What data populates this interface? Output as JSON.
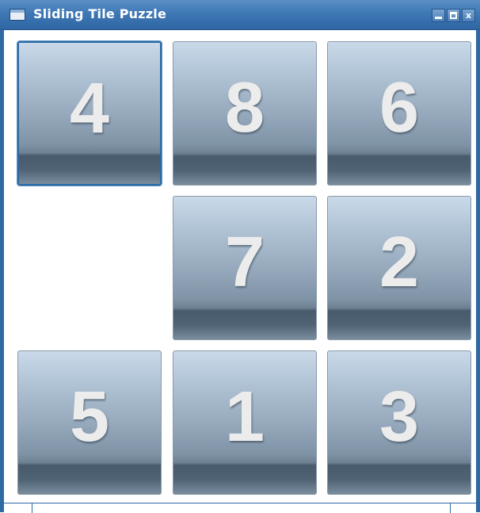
{
  "window": {
    "title": "Sliding Tile Puzzle",
    "buttons": {
      "close_label": "x"
    }
  },
  "colors": {
    "titlebar": "#3e78b5",
    "tile_top": "#c9d9e9",
    "tile_bottom": "#485b6c",
    "tile_text": "#ececec",
    "focus_border": "#2d6aa3"
  },
  "board": {
    "rows": [
      [
        "4",
        "8",
        "6"
      ],
      [
        "",
        "7",
        "2"
      ],
      [
        "5",
        "1",
        "3"
      ]
    ],
    "empty_position": "row 2, column 1"
  }
}
